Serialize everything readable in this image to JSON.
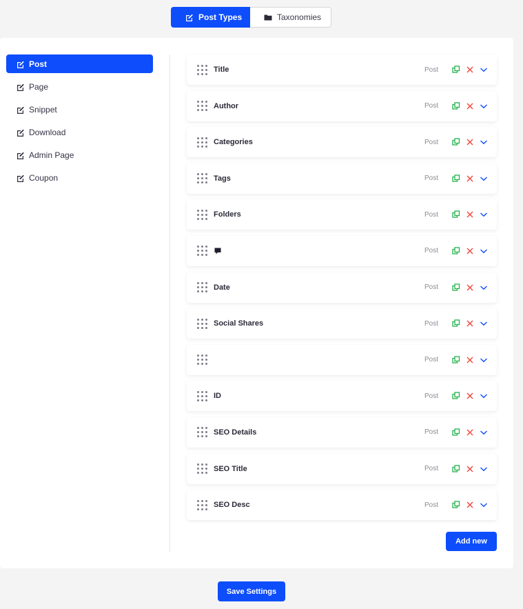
{
  "top_tabs": [
    {
      "label": "Post Types",
      "icon": "edit-icon",
      "active": true
    },
    {
      "label": "Taxonomies",
      "icon": "folder-icon",
      "active": false
    }
  ],
  "sidebar": {
    "items": [
      {
        "label": "Post",
        "icon": "edit-icon",
        "active": true
      },
      {
        "label": "Page",
        "icon": "edit-icon"
      },
      {
        "label": "Snippet",
        "icon": "edit-icon"
      },
      {
        "label": "Download",
        "icon": "edit-icon"
      },
      {
        "label": "Admin Page",
        "icon": "edit-icon"
      },
      {
        "label": "Coupon",
        "icon": "edit-icon"
      }
    ]
  },
  "fields": [
    {
      "label": "Title",
      "type": "Post"
    },
    {
      "label": "Author",
      "type": "Post"
    },
    {
      "label": "Categories",
      "type": "Post"
    },
    {
      "label": "Tags",
      "type": "Post"
    },
    {
      "label": "Folders",
      "type": "Post"
    },
    {
      "label": "",
      "icon": "comment-icon",
      "type": "Post"
    },
    {
      "label": "Date",
      "type": "Post"
    },
    {
      "label": "Social Shares",
      "type": "Post"
    },
    {
      "label": "",
      "type": "Post"
    },
    {
      "label": "ID",
      "type": "Post"
    },
    {
      "label": "SEO Details",
      "type": "Post"
    },
    {
      "label": "SEO Title",
      "type": "Post"
    },
    {
      "label": "SEO Desc",
      "type": "Post"
    }
  ],
  "buttons": {
    "add_new": "Add new",
    "save_settings": "Save Settings"
  },
  "colors": {
    "accent": "#0d4dfb",
    "copy": "#22b14c",
    "delete": "#f04438",
    "expand": "#0d4dfb"
  }
}
